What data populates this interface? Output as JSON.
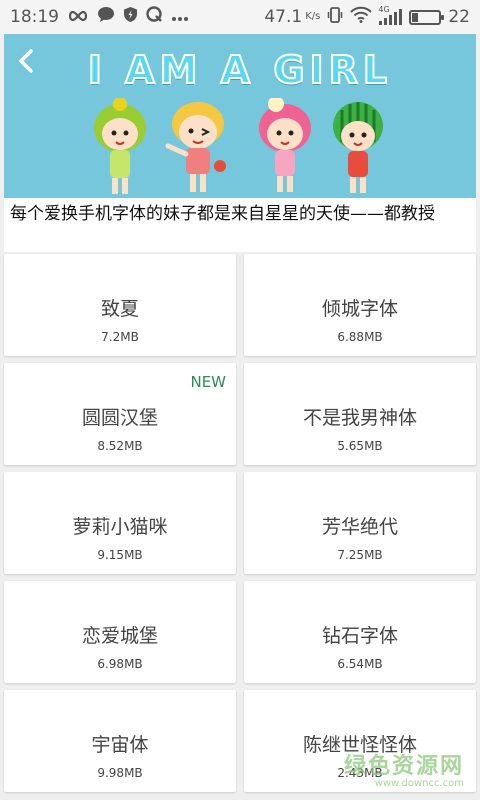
{
  "status_bar": {
    "time": "18:19",
    "speed": "47.1",
    "speed_unit": "K/s",
    "network": "4G",
    "battery_level": "22",
    "icons": [
      "infinity-icon",
      "chat-bubble-icon",
      "shield-icon",
      "q-icon",
      "more-icon",
      "vibrate-icon",
      "wifi-icon",
      "signal-icon",
      "battery-icon"
    ]
  },
  "banner": {
    "title": "I AM A GIRL",
    "back_icon": "chevron-left-icon",
    "background": "#76c7db"
  },
  "caption": "每个爱换手机字体的妹子都是来自星星的天使——都教授",
  "fonts": [
    {
      "name": "致夏",
      "size": "7.2MB",
      "badge": ""
    },
    {
      "name": "倾城字体",
      "size": "6.88MB",
      "badge": ""
    },
    {
      "name": "圆圆汉堡",
      "size": "8.52MB",
      "badge": "NEW"
    },
    {
      "name": "不是我男神体",
      "size": "5.65MB",
      "badge": ""
    },
    {
      "name": "萝莉小猫咪",
      "size": "9.15MB",
      "badge": ""
    },
    {
      "name": "芳华绝代",
      "size": "7.25MB",
      "badge": ""
    },
    {
      "name": "恋爱城堡",
      "size": "6.98MB",
      "badge": ""
    },
    {
      "name": "钻石字体",
      "size": "6.54MB",
      "badge": ""
    },
    {
      "name": "宇宙体",
      "size": "9.98MB",
      "badge": ""
    },
    {
      "name": "陈继世怪怪体",
      "size": "2.43MB",
      "badge": ""
    }
  ],
  "watermark": {
    "main": "绿色资源网",
    "sub": "www.downcc.com"
  },
  "colors": {
    "badge_green": "#2e8b57",
    "page_bg": "#efefef"
  }
}
